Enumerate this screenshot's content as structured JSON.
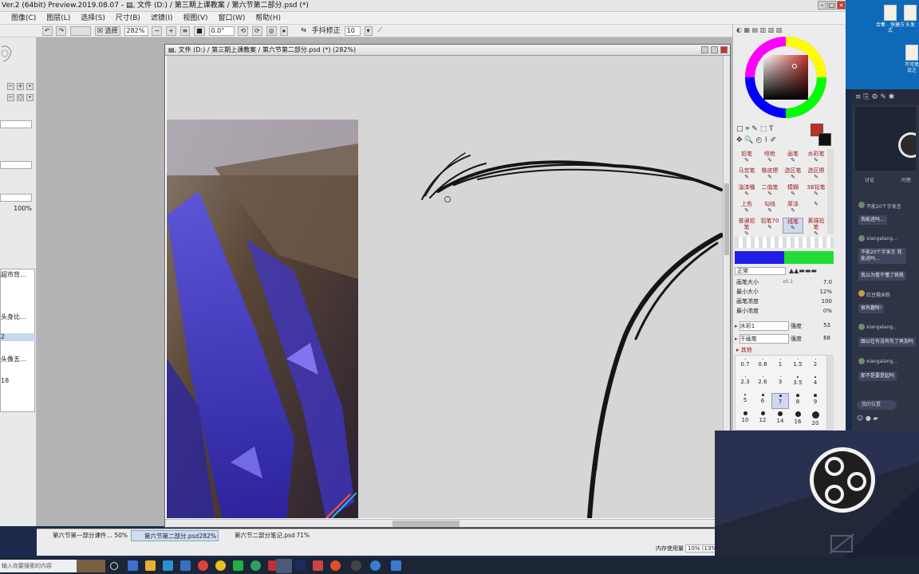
{
  "window": {
    "title": "Ver.2 (64bit) Preview.2019.08.07 - ▤, 文件 (D:) / 第三期上课教案 / 第六节第二部分.psd (*)"
  },
  "menu": [
    "图像(C)",
    "图层(L)",
    "选择(S)",
    "尺寸(B)",
    "滤镜(I)",
    "视图(V)",
    "窗口(W)",
    "帮助(H)"
  ],
  "toolbar": {
    "select_label": "选择",
    "zoom": "282%",
    "rotation": "0.0°",
    "stabilizer_label": "手抖修正",
    "stabilizer_value": "10"
  },
  "left_panel": {
    "percent": "100%",
    "layers": [
      "超市背…",
      "头身比…",
      "2",
      "头像五…",
      "18"
    ]
  },
  "document": {
    "title": "▤, 文件 (D:) / 第三期上课教案 / 第六节第二部分.psd (*) (282%)"
  },
  "right_panel": {
    "brush_tools": [
      [
        "铅笔",
        "喷枪",
        "画笔",
        "水彩笔"
      ],
      [
        "马克笔",
        "橡皮擦",
        "选区笔",
        "选区擦"
      ],
      [
        "油漆桶",
        "二值笔",
        "模糊",
        "3B铅笔"
      ],
      [
        "上色",
        "勾线",
        "厚涂",
        ""
      ],
      [
        "普通铅笔",
        "铅笔70",
        "线笔",
        "素描铅笔"
      ]
    ],
    "blend_mode": "正常",
    "props": [
      {
        "label": "画笔大小",
        "mult": "x0.1",
        "value": "7.0"
      },
      {
        "label": "最小大小",
        "mult": "",
        "value": "12%"
      },
      {
        "label": "画笔浓度",
        "mult": "",
        "value": "100"
      },
      {
        "label": "最小浓度",
        "mult": "",
        "value": "0%"
      }
    ],
    "texture_a": {
      "name": "水彩1",
      "strength_label": "强度",
      "strength": "53"
    },
    "texture_b": {
      "name": "干画笔",
      "strength_label": "强度",
      "strength": "68"
    },
    "other_label": "其他",
    "brush_sizes": [
      "0.7",
      "0.8",
      "1",
      "1.5",
      "2",
      "2.3",
      "2.6",
      "3",
      "3.5",
      "4",
      "5",
      "6",
      "7",
      "8",
      "9",
      "10",
      "12",
      "14",
      "16",
      "20"
    ],
    "colors": {
      "main": "#c0302a",
      "sub": "#111111",
      "bar_blue": "#1f1fe6",
      "bar_green": "#22dd33"
    }
  },
  "doc_tabs": [
    {
      "name": "第六节第一部分课件...",
      "zoom": "50%"
    },
    {
      "name": "第六节第二部分.psd",
      "zoom": "282%"
    },
    {
      "name": "第六节二部分笔记.psd",
      "zoom": "71%"
    }
  ],
  "status": {
    "memory_label": "内存使用量",
    "memory_value": "10% (13%)"
  },
  "taskbar": {
    "search_placeholder": "输入你要搜索的内容"
  },
  "desktop_icons": [
    "合集 - 快捷方式",
    "头发",
    "不可思议之"
  ],
  "chat": {
    "tabs": [
      "讨论",
      "问答"
    ],
    "messages": [
      {
        "user": "不能20个字发言",
        "text": "我能进吗…"
      },
      {
        "user": "xiangalang...",
        "text": "不能20个字发言 我能进吗…"
      },
      {
        "user": "",
        "text": "我以为看不懂了帆帆"
      },
      {
        "user": "红豆糯米粉",
        "text": "很有趣呀!"
      },
      {
        "user": "xiangalang...",
        "text": "跟以往有没有先了再加吗"
      },
      {
        "user": "xiangalang...",
        "text": "那不是要是起吗"
      }
    ],
    "input_placeholder": "我的位置"
  }
}
